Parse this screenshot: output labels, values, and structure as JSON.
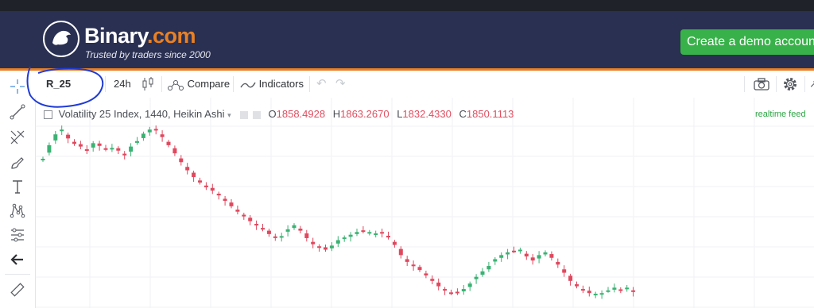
{
  "header": {
    "logo_text": "Binary",
    "logo_suffix": ".com",
    "tagline": "Trusted by traders since 2000",
    "demo_button": "Create a demo account"
  },
  "toolbar": {
    "symbol": "R_25",
    "interval": "24h",
    "compare_label": "Compare",
    "indicators_label": "Indicators"
  },
  "legend": {
    "title": "Volatility 25 Index, 1440, Heikin Ashi",
    "o_label": "O",
    "o_value": "1858.4928",
    "h_label": "H",
    "h_value": "1863.2670",
    "l_label": "L",
    "l_value": "1832.4330",
    "c_label": "C",
    "c_value": "1850.1113",
    "feed_status": "realtime feed"
  },
  "colors": {
    "header_bg": "#2a3052",
    "brand_orange": "#e98024",
    "demo_green": "#39b14a",
    "candle_up": "#3bb273",
    "candle_down": "#e0485e",
    "annotation_blue": "#1f3bd6"
  },
  "icons": [
    "crosshair-icon",
    "trend-line-icon",
    "fib-icon",
    "brush-icon",
    "text-icon",
    "pattern-icon",
    "measure-icon",
    "back-arrow-icon",
    "ruler-icon",
    "candle-type-icon",
    "compare-icon",
    "indicators-icon",
    "undo-icon",
    "redo-icon",
    "camera-icon",
    "gear-icon"
  ],
  "chart_data": {
    "type": "candlestick",
    "style": "Heikin Ashi",
    "title": "Volatility 25 Index, 1440, Heikin Ashi",
    "trend": "declining then partial recovery",
    "candles_close": [
      1850,
      1870,
      1886,
      1893,
      1880,
      1872,
      1868,
      1862,
      1873,
      1869,
      1864,
      1866,
      1862,
      1855,
      1868,
      1876,
      1887,
      1893,
      1892,
      1882,
      1870,
      1858,
      1845,
      1833,
      1823,
      1815,
      1808,
      1803,
      1796,
      1788,
      1780,
      1772,
      1765,
      1758,
      1752,
      1746,
      1739,
      1734,
      1736,
      1746,
      1752,
      1744,
      1733,
      1724,
      1720,
      1716,
      1722,
      1730,
      1734,
      1738,
      1742,
      1744,
      1742,
      1740,
      1741,
      1734,
      1723,
      1708,
      1698,
      1692,
      1686,
      1678,
      1670,
      1662,
      1656,
      1652,
      1653,
      1658,
      1666,
      1676,
      1684,
      1692,
      1702,
      1708,
      1712,
      1714,
      1716,
      1706,
      1700,
      1708,
      1712,
      1704,
      1694,
      1682,
      1670,
      1662,
      1656,
      1652,
      1651,
      1652,
      1656,
      1660,
      1657,
      1660,
      1654
    ]
  }
}
